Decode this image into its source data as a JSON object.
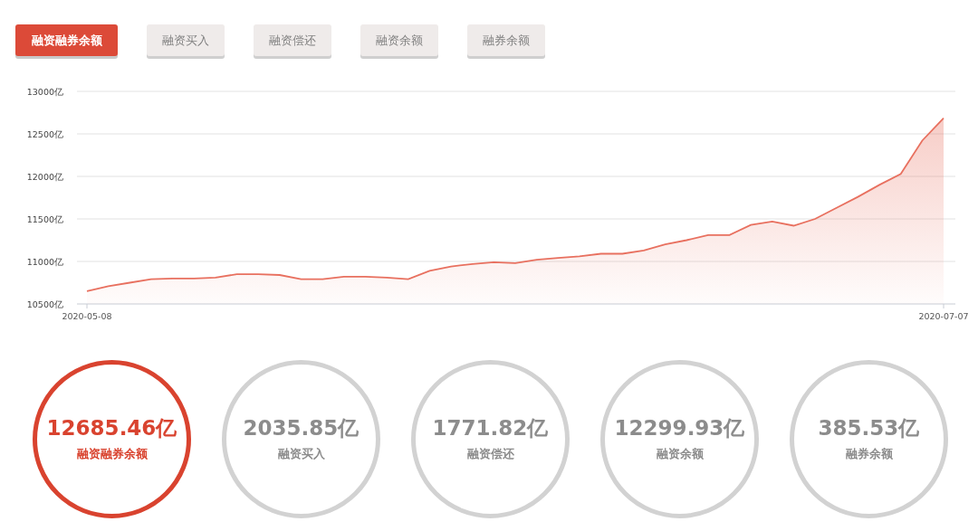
{
  "tabs": [
    {
      "label": "融资融券余额",
      "selected": true
    },
    {
      "label": "融资买入",
      "selected": false
    },
    {
      "label": "融资偿还",
      "selected": false
    },
    {
      "label": "融资余额",
      "selected": false
    },
    {
      "label": "融券余额",
      "selected": false
    }
  ],
  "chart": {
    "chart_data": {
      "type": "area",
      "categories": [
        "2020-05-08",
        null,
        null,
        null,
        null,
        null,
        null,
        null,
        null,
        null,
        null,
        null,
        null,
        null,
        null,
        null,
        null,
        null,
        null,
        null,
        null,
        null,
        null,
        null,
        null,
        null,
        null,
        null,
        null,
        null,
        null,
        null,
        null,
        null,
        null,
        null,
        null,
        null,
        null,
        null,
        "2020-07-07"
      ],
      "series": [
        {
          "color": "#e8705f",
          "values": [
            10650,
            10710,
            10750,
            10790,
            10800,
            10800,
            10810,
            10850,
            10850,
            10840,
            10790,
            10790,
            10820,
            10820,
            10810,
            10790,
            10890,
            10940,
            10970,
            10990,
            10980,
            11020,
            11040,
            11060,
            11090,
            11090,
            11130,
            11200,
            11250,
            11310,
            11310,
            11430,
            11470,
            11420,
            11500,
            11630,
            11760,
            11900,
            12030,
            12420,
            12685
          ]
        }
      ],
      "grid": true,
      "ylim": [
        10500,
        13000
      ],
      "yticks": [
        {
          "value": 10500,
          "label": "10500亿"
        },
        {
          "value": 11000,
          "label": "11000亿"
        },
        {
          "value": 11500,
          "label": "11500亿"
        },
        {
          "value": 12000,
          "label": "12000亿"
        },
        {
          "value": 12500,
          "label": "12500亿"
        },
        {
          "value": 13000,
          "label": "13000亿"
        }
      ]
    }
  },
  "stats": [
    {
      "value": "12685.46亿",
      "label": "融资融券余额",
      "selected": true
    },
    {
      "value": "2035.85亿",
      "label": "融资买入",
      "selected": false
    },
    {
      "value": "1771.82亿",
      "label": "融资偿还",
      "selected": false
    },
    {
      "value": "12299.93亿",
      "label": "融资余额",
      "selected": false
    },
    {
      "value": "385.53亿",
      "label": "融券余额",
      "selected": false
    }
  ]
}
